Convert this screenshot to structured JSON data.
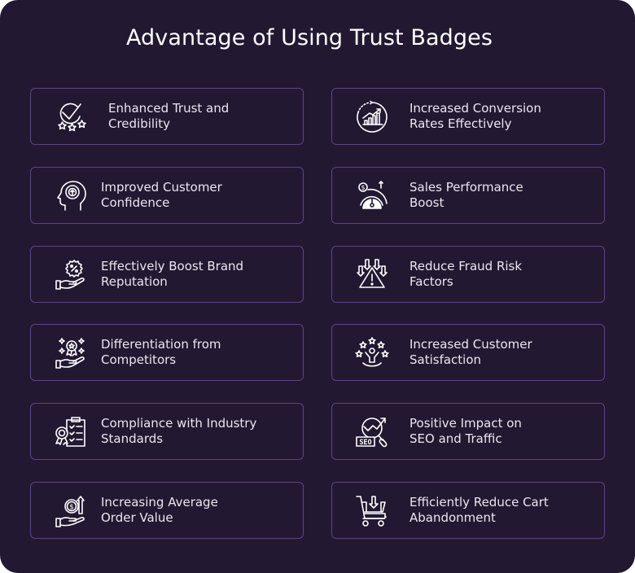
{
  "title": "Advantage of Using Trust Badges",
  "colors": {
    "background": "#231832",
    "card_border": "#5d4283",
    "text": "#ece6f0"
  },
  "cards": [
    {
      "line1": "Enhanced Trust and",
      "line2": "Credibility",
      "icon": "check-stars-icon"
    },
    {
      "line1": "Increased Conversion",
      "line2": "Rates Effectively",
      "icon": "growth-chart-icon"
    },
    {
      "line1": "Improved Customer",
      "line2": "Confidence",
      "icon": "head-gear-icon"
    },
    {
      "line1": "Sales Performance",
      "line2": "Boost",
      "icon": "speedometer-dollar-icon"
    },
    {
      "line1": "Effectively Boost Brand",
      "line2": "Reputation",
      "icon": "hand-discount-icon"
    },
    {
      "line1": "Reduce Fraud Risk",
      "line2": "Factors",
      "icon": "warning-arrows-icon"
    },
    {
      "line1": "Differentiation from",
      "line2": "Competitors",
      "icon": "hand-award-icon"
    },
    {
      "line1": "Increased Customer",
      "line2": "Satisfaction",
      "icon": "person-stars-icon"
    },
    {
      "line1": "Compliance with Industry",
      "line2": "Standards",
      "icon": "clipboard-badge-icon"
    },
    {
      "line1": "Positive Impact on",
      "line2": "SEO and Traffic",
      "icon": "seo-magnifier-icon"
    },
    {
      "line1": "Increasing Average",
      "line2": "Order Value",
      "icon": "hand-coin-arrow-icon"
    },
    {
      "line1": "Efficiently Reduce Cart",
      "line2": "Abandonment",
      "icon": "cart-download-icon"
    }
  ]
}
